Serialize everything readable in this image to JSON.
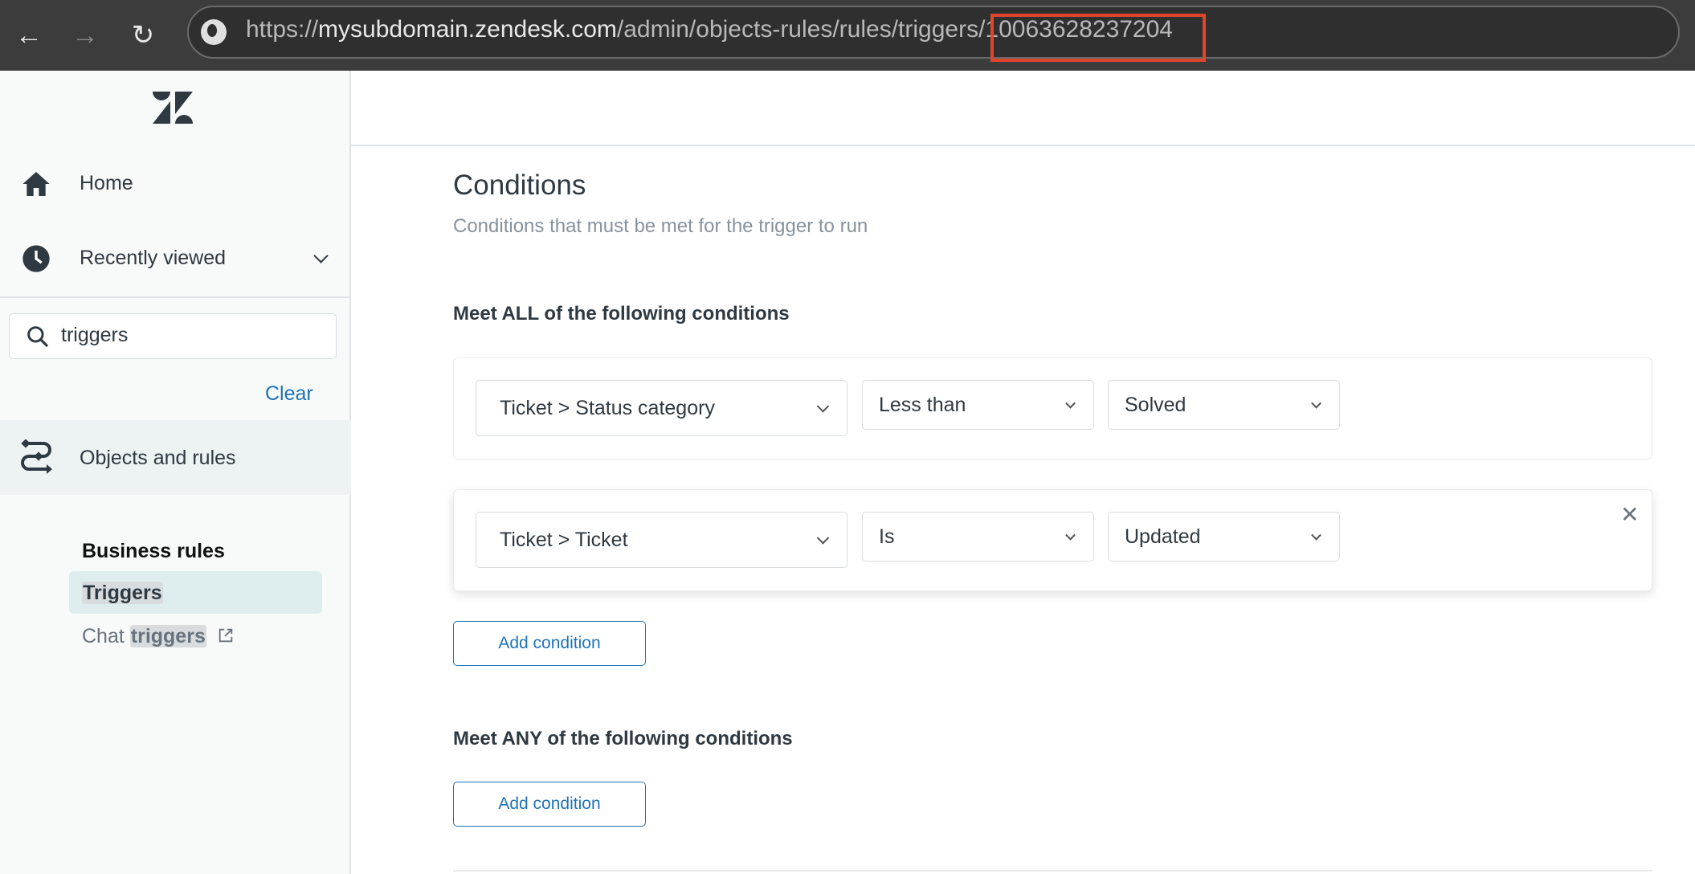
{
  "browser": {
    "url_prefix": "https://",
    "url_host": "mysubdomain.zendesk.com",
    "url_path": "/admin/objects-rules/rules/triggers/",
    "url_id": "10063628237204",
    "back_icon": "arrow-left",
    "forward_icon": "arrow-right",
    "reload_icon": "reload",
    "site_icon": "globe",
    "highlight_color": "#e0452c"
  },
  "sidebar": {
    "logo": "Zendesk",
    "home": "Home",
    "recently_viewed": "Recently viewed",
    "search_value": "triggers",
    "clear": "Clear",
    "objects_rules": "Objects and rules",
    "section": "Business rules",
    "triggers": "Triggers",
    "chat_prefix": "Chat ",
    "chat_highlight": "triggers"
  },
  "main": {
    "title": "Conditions",
    "subtitle": "Conditions that must be met for the trigger to run",
    "all_heading": "Meet ALL of the following conditions",
    "all_conditions": [
      {
        "field": "Ticket > Status category",
        "operator": "Less than",
        "value": "Solved"
      },
      {
        "field": "Ticket > Ticket",
        "operator": "Is",
        "value": "Updated"
      }
    ],
    "add_condition": "Add condition",
    "any_heading": "Meet ANY of the following conditions",
    "add_condition_any": "Add condition"
  },
  "colors": {
    "accent": "#1f73b7",
    "sidebar_active": "#deeded"
  }
}
